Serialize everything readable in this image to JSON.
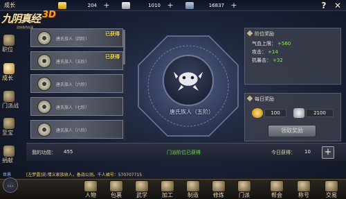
{
  "header": {
    "screen_title": "成长",
    "gold": "204",
    "silver": "1010",
    "tickets": "16837",
    "help_label": "?",
    "close_label": "✕"
  },
  "logo": {
    "main": "九阴真经",
    "suffix": "3D",
    "sub": "武侠角色扮演"
  },
  "tabs": [
    {
      "label": "职位",
      "active": false
    },
    {
      "label": "成长",
      "active": true
    },
    {
      "label": "门派战",
      "active": false
    },
    {
      "label": "至宝",
      "active": false
    },
    {
      "label": "捐献",
      "active": false
    }
  ],
  "achievements": [
    {
      "label": "唐氏族人（四阶）",
      "status": "已获得"
    },
    {
      "label": "唐氏族人（五阶）",
      "status": "已获得"
    },
    {
      "label": "唐氏族人（六阶）",
      "status": ""
    },
    {
      "label": "唐氏族人（七阶）",
      "status": ""
    },
    {
      "label": "唐氏族人（八阶）",
      "status": ""
    }
  ],
  "current_rank": "唐氏族人（五阶）",
  "rank_reward": {
    "title": "阶位奖励",
    "stats": [
      {
        "name": "气血上限：",
        "value": "+560"
      },
      {
        "name": "攻击：",
        "value": "+14"
      },
      {
        "name": "抗暴击：",
        "value": "+32"
      }
    ]
  },
  "daily_reward": {
    "title": "每日奖励",
    "gold": "100",
    "silver": "2100",
    "claim_label": "领取奖励"
  },
  "info_bar": {
    "merit_label": "我的功勋：",
    "merit_value": "455",
    "rank_status": "门派阶位已获得",
    "today_label": "今日获得：",
    "today_value": "10",
    "add_label": "+"
  },
  "chat": {
    "channel": "世界",
    "message": "[左梦露]说:情义家族收人，备战公测。千人裙号：570707715"
  },
  "menu": [
    {
      "label": "人物",
      "icon": "person-icon"
    },
    {
      "label": "包裹",
      "icon": "bag-icon"
    },
    {
      "label": "武学",
      "icon": "martial-arts-icon"
    },
    {
      "label": "加工",
      "icon": "crafting-icon"
    },
    {
      "label": "制造",
      "icon": "forge-icon"
    },
    {
      "label": "修炼",
      "icon": "cultivation-icon"
    },
    {
      "label": "门派",
      "icon": "sect-icon"
    },
    {
      "label": "帮会",
      "icon": "guild-icon"
    },
    {
      "label": "称号",
      "icon": "title-icon"
    },
    {
      "label": "交易",
      "icon": "trade-icon"
    }
  ],
  "colors": {
    "obtained": "#ffe24a",
    "stat_value": "#8ce86a",
    "chat_message": "#ffd24a"
  }
}
